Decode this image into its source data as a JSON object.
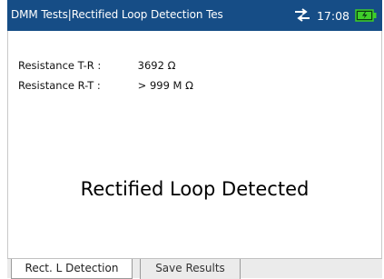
{
  "titlebar": {
    "title": "DMM Tests|Rectified Loop Detection Tes",
    "time": "17:08",
    "network_icon": "network-arrows-icon",
    "battery_icon": "battery-icon",
    "battery_level": 1.0,
    "colors": {
      "bar": "#164d86",
      "battery": "#3fcf2a"
    }
  },
  "measurements": [
    {
      "label": "Resistance T-R :",
      "value": "3692 Ω"
    },
    {
      "label": "Resistance R-T :",
      "value": "> 999 M Ω"
    }
  ],
  "result": "Rectified Loop Detected",
  "tabs": [
    {
      "label": "Rect. L Detection",
      "active": true
    },
    {
      "label": "Save Results",
      "active": false
    }
  ]
}
